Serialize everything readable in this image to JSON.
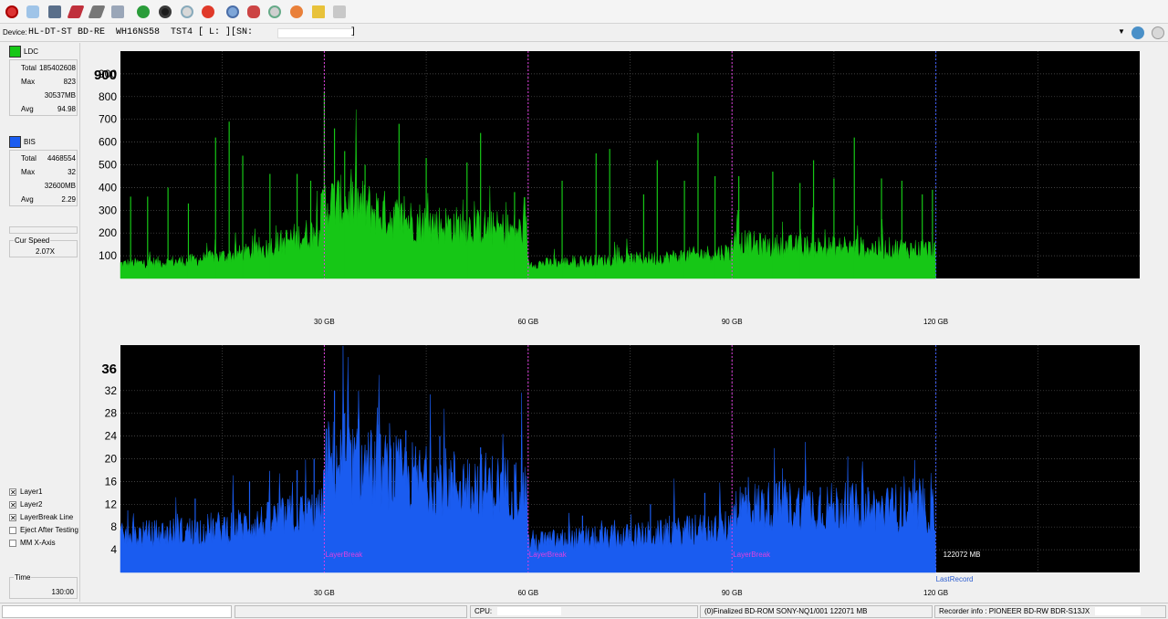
{
  "toolbar": {
    "icons": [
      "power-icon",
      "drive-icon",
      "monitor-icon",
      "red-disc-icon",
      "gray-disc-icon",
      "eject-icon",
      "refresh-icon",
      "green-disc-icon",
      "scan-icon",
      "stop-icon",
      "blue-disc-icon",
      "burn-icon",
      "copy-icon",
      "fire-icon",
      "chart-icon",
      "settings-icon"
    ]
  },
  "device": {
    "label": "Device:",
    "drive": "HL-DT-ST BD-RE  WH16NS58  TST4 [ L: ][SN:",
    "end": "]"
  },
  "ldc": {
    "label": "LDC",
    "color": "#16c716",
    "total_label": "Total",
    "total": "185402608",
    "max_label": "Max",
    "max": "823",
    "mb": "30537MB",
    "avg_label": "Avg",
    "avg": "94.98"
  },
  "bis": {
    "label": "BIS",
    "color": "#1a5cf0",
    "total_label": "Total",
    "total": "4468554",
    "max_label": "Max",
    "max": "32",
    "mb": "32600MB",
    "avg_label": "Avg",
    "avg": "2.29"
  },
  "speed": {
    "label": "Cur Speed",
    "value": "2.07X"
  },
  "options": [
    {
      "label": "Layer1",
      "checked": true
    },
    {
      "label": "Layer2",
      "checked": true
    },
    {
      "label": "LayerBreak Line",
      "checked": true
    },
    {
      "label": "Eject After Testing",
      "checked": false
    },
    {
      "label": "MM X-Axis",
      "checked": false
    }
  ],
  "time": {
    "label": "Time",
    "value": "130:00"
  },
  "chart_data": [
    {
      "type": "area",
      "series": [
        {
          "name": "LDC",
          "color": "#16c716"
        }
      ],
      "ylim": [
        0,
        1000
      ],
      "yticks": [
        100,
        200,
        300,
        400,
        500,
        600,
        700,
        800,
        900
      ],
      "ytop_label": "900",
      "xlim": [
        0,
        150
      ],
      "xticks": [
        "30 GB",
        "60 GB",
        "90 GB",
        "120 GB"
      ],
      "xtick_values": [
        30,
        60,
        90,
        120
      ],
      "layer_breaks": [
        30,
        60,
        90
      ],
      "end_marker": 120,
      "profile": [
        [
          0,
          70
        ],
        [
          10,
          85
        ],
        [
          20,
          130
        ],
        [
          25,
          190
        ],
        [
          29,
          230
        ],
        [
          30,
          370
        ],
        [
          35,
          360
        ],
        [
          40,
          300
        ],
        [
          45,
          270
        ],
        [
          55,
          240
        ],
        [
          59.8,
          230
        ],
        [
          60,
          70
        ],
        [
          70,
          85
        ],
        [
          80,
          100
        ],
        [
          89.8,
          130
        ],
        [
          90,
          180
        ],
        [
          95,
          160
        ],
        [
          105,
          150
        ],
        [
          115,
          145
        ],
        [
          119.8,
          140
        ]
      ],
      "spikes": [
        [
          1.5,
          360
        ],
        [
          4,
          360
        ],
        [
          7,
          400
        ],
        [
          10,
          330
        ],
        [
          14,
          620
        ],
        [
          16,
          690
        ],
        [
          18,
          540
        ],
        [
          22,
          460
        ],
        [
          26,
          460
        ],
        [
          28,
          430
        ],
        [
          30,
          820
        ],
        [
          31.5,
          660
        ],
        [
          33,
          560
        ],
        [
          36,
          500
        ],
        [
          41,
          680
        ],
        [
          45,
          530
        ],
        [
          51,
          510
        ],
        [
          53,
          640
        ],
        [
          58,
          380
        ],
        [
          65,
          430
        ],
        [
          70,
          550
        ],
        [
          72,
          570
        ],
        [
          77,
          370
        ],
        [
          79,
          520
        ],
        [
          83,
          430
        ],
        [
          85,
          640
        ],
        [
          87.5,
          450
        ],
        [
          91,
          450
        ],
        [
          96,
          470
        ],
        [
          100,
          420
        ],
        [
          102,
          520
        ],
        [
          105,
          440
        ],
        [
          108,
          620
        ],
        [
          112,
          440
        ],
        [
          115,
          430
        ],
        [
          118,
          370
        ],
        [
          119.5,
          390
        ]
      ]
    },
    {
      "type": "area",
      "series": [
        {
          "name": "BIS",
          "color": "#1a5cf0"
        }
      ],
      "ylim": [
        0,
        40
      ],
      "yticks": [
        4,
        8,
        12,
        16,
        20,
        24,
        28,
        32
      ],
      "ytop_label": "36",
      "xlim": [
        0,
        150
      ],
      "xticks": [
        "30 GB",
        "60 GB",
        "90 GB",
        "120 GB"
      ],
      "xtick_values": [
        30,
        60,
        90,
        120
      ],
      "layer_breaks": [
        30,
        60,
        90
      ],
      "layer_break_label": "LayerBreak",
      "end_marker": 120,
      "end_label": "122072 MB",
      "last_record_label": "LastRecord",
      "profile": [
        [
          0,
          7
        ],
        [
          10,
          8
        ],
        [
          20,
          9.5
        ],
        [
          25,
          11
        ],
        [
          29.8,
          12
        ],
        [
          30,
          22
        ],
        [
          35,
          21
        ],
        [
          45,
          18
        ],
        [
          55,
          17
        ],
        [
          59.8,
          16
        ],
        [
          60,
          6
        ],
        [
          70,
          6.5
        ],
        [
          80,
          7.5
        ],
        [
          89.8,
          9
        ],
        [
          90,
          13
        ],
        [
          100,
          13
        ],
        [
          110,
          12.5
        ],
        [
          119.8,
          12
        ]
      ],
      "spikes": [
        [
          11,
          13
        ],
        [
          19,
          16
        ],
        [
          26,
          18
        ],
        [
          28.5,
          20
        ],
        [
          31.5,
          32
        ],
        [
          33,
          28
        ],
        [
          35,
          27
        ],
        [
          38,
          26
        ],
        [
          42,
          25
        ],
        [
          47,
          24
        ],
        [
          53,
          22
        ],
        [
          58,
          19
        ],
        [
          68,
          10
        ],
        [
          78,
          12
        ],
        [
          86,
          14
        ],
        [
          92,
          15
        ],
        [
          97,
          16
        ],
        [
          103,
          15
        ],
        [
          110,
          15
        ],
        [
          117,
          14
        ]
      ]
    }
  ],
  "status": {
    "cpu_label": "CPU:",
    "disc_info": "(0)Finalized  BD-ROM  SONY-NQ1/001  122071 MB",
    "recorder": "Recorder info : PIONEER      BD-RW  BDR-S13JX"
  }
}
